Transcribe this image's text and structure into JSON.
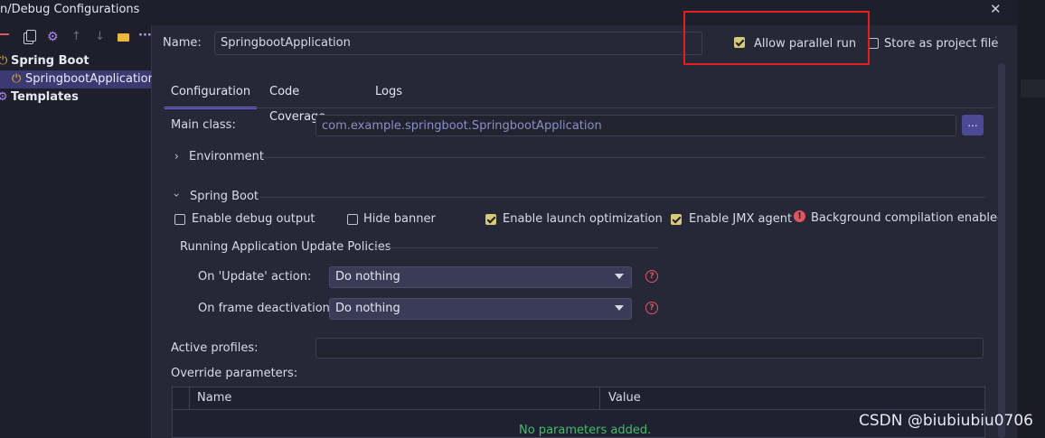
{
  "window": {
    "title": "n/Debug Configurations",
    "close": "✕"
  },
  "left_toolbar": {
    "icons": [
      "minus-icon",
      "copy-icon",
      "gear-icon",
      "arrow-up-icon",
      "arrow-down-icon",
      "folder-add-icon",
      "more-icon"
    ]
  },
  "tree": {
    "items": [
      {
        "label": "Spring Boot",
        "icon": "power-icon",
        "selected": false
      },
      {
        "label": "SpringbootApplication",
        "icon": "power-icon",
        "selected": true
      },
      {
        "label": "Templates",
        "icon": "gear-icon",
        "selected": false
      }
    ]
  },
  "header": {
    "name_label": "Name:",
    "name_value": "SpringbootApplication",
    "allow_parallel_label": "Allow parallel run",
    "allow_parallel_checked": true,
    "store_label": "Store as project file",
    "store_checked": false
  },
  "tabs": [
    {
      "label": "Configuration",
      "active": true
    },
    {
      "label": "Code Coverage",
      "active": false
    },
    {
      "label": "Logs",
      "active": false
    }
  ],
  "config": {
    "main_class_label": "Main class:",
    "main_class_value": "com.example.springboot.SpringbootApplication",
    "browse_label": "...",
    "environment_label": "Environment",
    "spring_boot_label": "Spring Boot",
    "options": [
      {
        "label": "Enable debug output",
        "checked": false
      },
      {
        "label": "Hide banner",
        "checked": false
      },
      {
        "label": "Enable launch optimization",
        "checked": true
      },
      {
        "label": "Enable JMX agent",
        "checked": true
      }
    ],
    "background_compilation_label": "Background compilation enabled",
    "policies_label": "Running Application Update Policies",
    "on_update_label": "On 'Update' action:",
    "on_update_value": "Do nothing",
    "on_frame_label": "On frame deactivation:",
    "on_frame_value": "Do nothing",
    "help": "?",
    "active_profiles_label": "Active profiles:",
    "override_label": "Override parameters:",
    "table_columns": [
      "Name",
      "Value"
    ],
    "table_empty": "No parameters added."
  },
  "watermark": "CSDN @biubiubiu0706",
  "colors": {
    "accent": "#6b63d8",
    "highlight_box": "#e0201f",
    "empty_text": "#3fbf67",
    "checkbox": "#d6c979"
  }
}
